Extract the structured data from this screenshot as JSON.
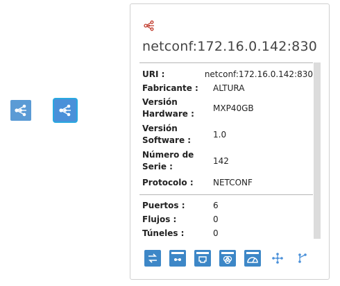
{
  "colors": {
    "node_fill": "#4a90d9",
    "selected_border": "#29a8e0",
    "panel_icon": "#c0392b",
    "toolbar_fill": "#3d87c7"
  },
  "canvas": {
    "nodes": [
      {
        "icon": "network-node-icon",
        "selected": false
      },
      {
        "icon": "network-node-icon",
        "selected": true
      }
    ]
  },
  "panel": {
    "icon": "network-node-icon",
    "title": "netconf:172.16.0.142:830",
    "details": [
      {
        "label": "URI :",
        "value": "netconf:172.16.0.142:830"
      },
      {
        "label": "Fabricante :",
        "value": "ALTURA"
      },
      {
        "label": "Versión Hardware :",
        "value": "MXP40GB"
      },
      {
        "label": "Versión Software :",
        "value": "1.0"
      },
      {
        "label": "Número de Serie :",
        "value": "142"
      },
      {
        "label": "Protocolo :",
        "value": "NETCONF"
      }
    ],
    "counts": [
      {
        "label": "Puertos :",
        "value": "6"
      },
      {
        "label": "Flujos :",
        "value": "0"
      },
      {
        "label": "Túneles :",
        "value": "0"
      }
    ],
    "toolbar": [
      "switch-arrows-icon",
      "device-ports-icon",
      "ethernet-port-icon",
      "circles-link-icon",
      "gauge-icon",
      "network-node-icon",
      "branch-icon"
    ]
  }
}
